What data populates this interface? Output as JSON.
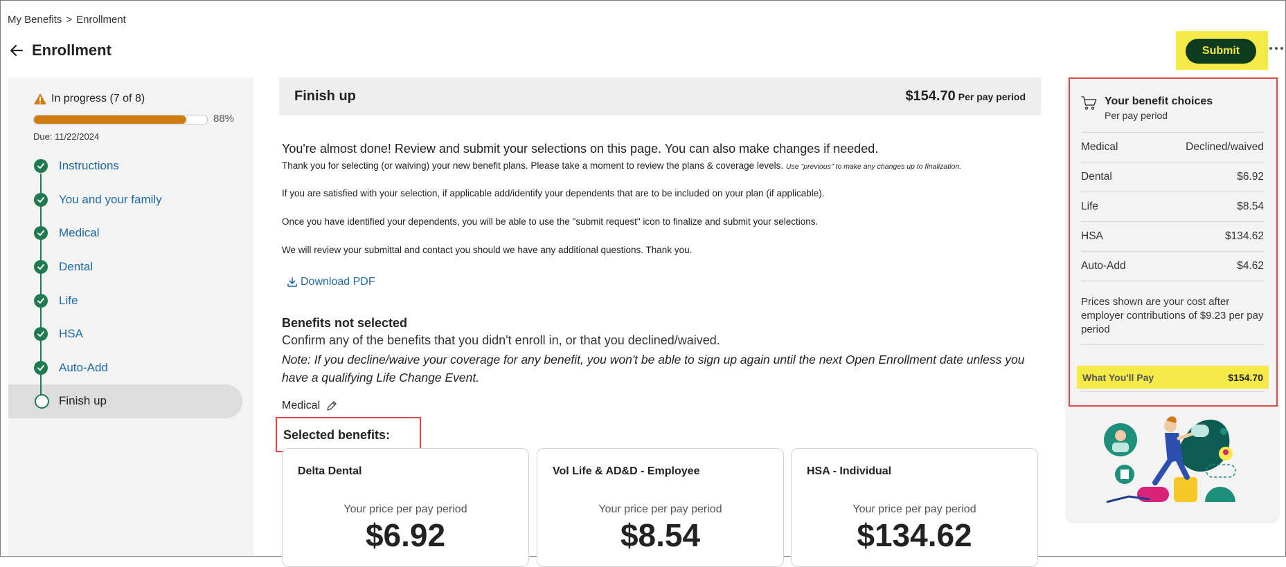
{
  "breadcrumb": {
    "home": "My Benefits",
    "separator": ">",
    "current": "Enrollment"
  },
  "header": {
    "title": "Enrollment",
    "submit_label": "Submit"
  },
  "colors": {
    "accent_green": "#0e3b1e",
    "step_green": "#1f7a52",
    "highlight_yellow": "#f6ea48",
    "progress_orange": "#d07a12",
    "link_blue": "#1e6aa7",
    "callout_red": "#e04848"
  },
  "progress": {
    "status": "In progress (7 of 8)",
    "percent_label": "88%",
    "percent_value": 88,
    "due": "Due: 11/22/2024"
  },
  "steps": [
    {
      "label": "Instructions"
    },
    {
      "label": "You and your family"
    },
    {
      "label": "Medical"
    },
    {
      "label": "Dental"
    },
    {
      "label": "Life"
    },
    {
      "label": "HSA"
    },
    {
      "label": "Auto-Add"
    },
    {
      "label": "Finish up"
    }
  ],
  "finish": {
    "title": "Finish up",
    "amount": "$154.70",
    "per": "Per pay period"
  },
  "intro": {
    "lead": "You're almost done! Review and submit your selections on this page. You can also make changes if needed.",
    "p1": "Thank you for selecting (or waiving) your new benefit plans. Please take a moment to review the plans & coverage levels.",
    "p1_small": "Use \"previous\" to make any changes up to finalization.",
    "p2": "If you are satisfied with your selection, if applicable add/identify your dependents that are to be included on your plan (if applicable).",
    "p3": "Once you have identified your dependents, you will be able to use the \"submit request\" icon to finalize and submit your selections.",
    "p4": "We will review your submittal and contact you should we have any additional questions. Thank you."
  },
  "download": {
    "label": "Download PDF"
  },
  "not_selected": {
    "title": "Benefits not selected",
    "subtitle": "Confirm any of the benefits that you didn't enroll in, or that you declined/waived.",
    "note": "Note: If you decline/waive your coverage for any benefit, you won't be able to sign up again until the next Open Enrollment date unless you have a qualifying Life Change Event.",
    "item": "Medical"
  },
  "selected": {
    "title": "Selected benefits:",
    "cards": [
      {
        "name": "Delta Dental",
        "label": "Your price per pay period",
        "price": "$6.92"
      },
      {
        "name": "Vol Life & AD&D - Employee",
        "label": "Your price per pay period",
        "price": "$8.54"
      },
      {
        "name": "HSA - Individual",
        "label": "Your price per pay period",
        "price": "$134.62"
      }
    ]
  },
  "choices": {
    "title": "Your benefit choices",
    "subtitle": "Per pay period",
    "rows": [
      {
        "name": "Medical",
        "value": "Declined/waived"
      },
      {
        "name": "Dental",
        "value": "$6.92"
      },
      {
        "name": "Life",
        "value": "$8.54"
      },
      {
        "name": "HSA",
        "value": "$134.62"
      },
      {
        "name": "Auto-Add",
        "value": "$4.62"
      }
    ],
    "note": "Prices shown are your cost after employer contributions of $9.23 per pay period",
    "pay_label": "What You'll Pay",
    "pay_value": "$154.70"
  }
}
